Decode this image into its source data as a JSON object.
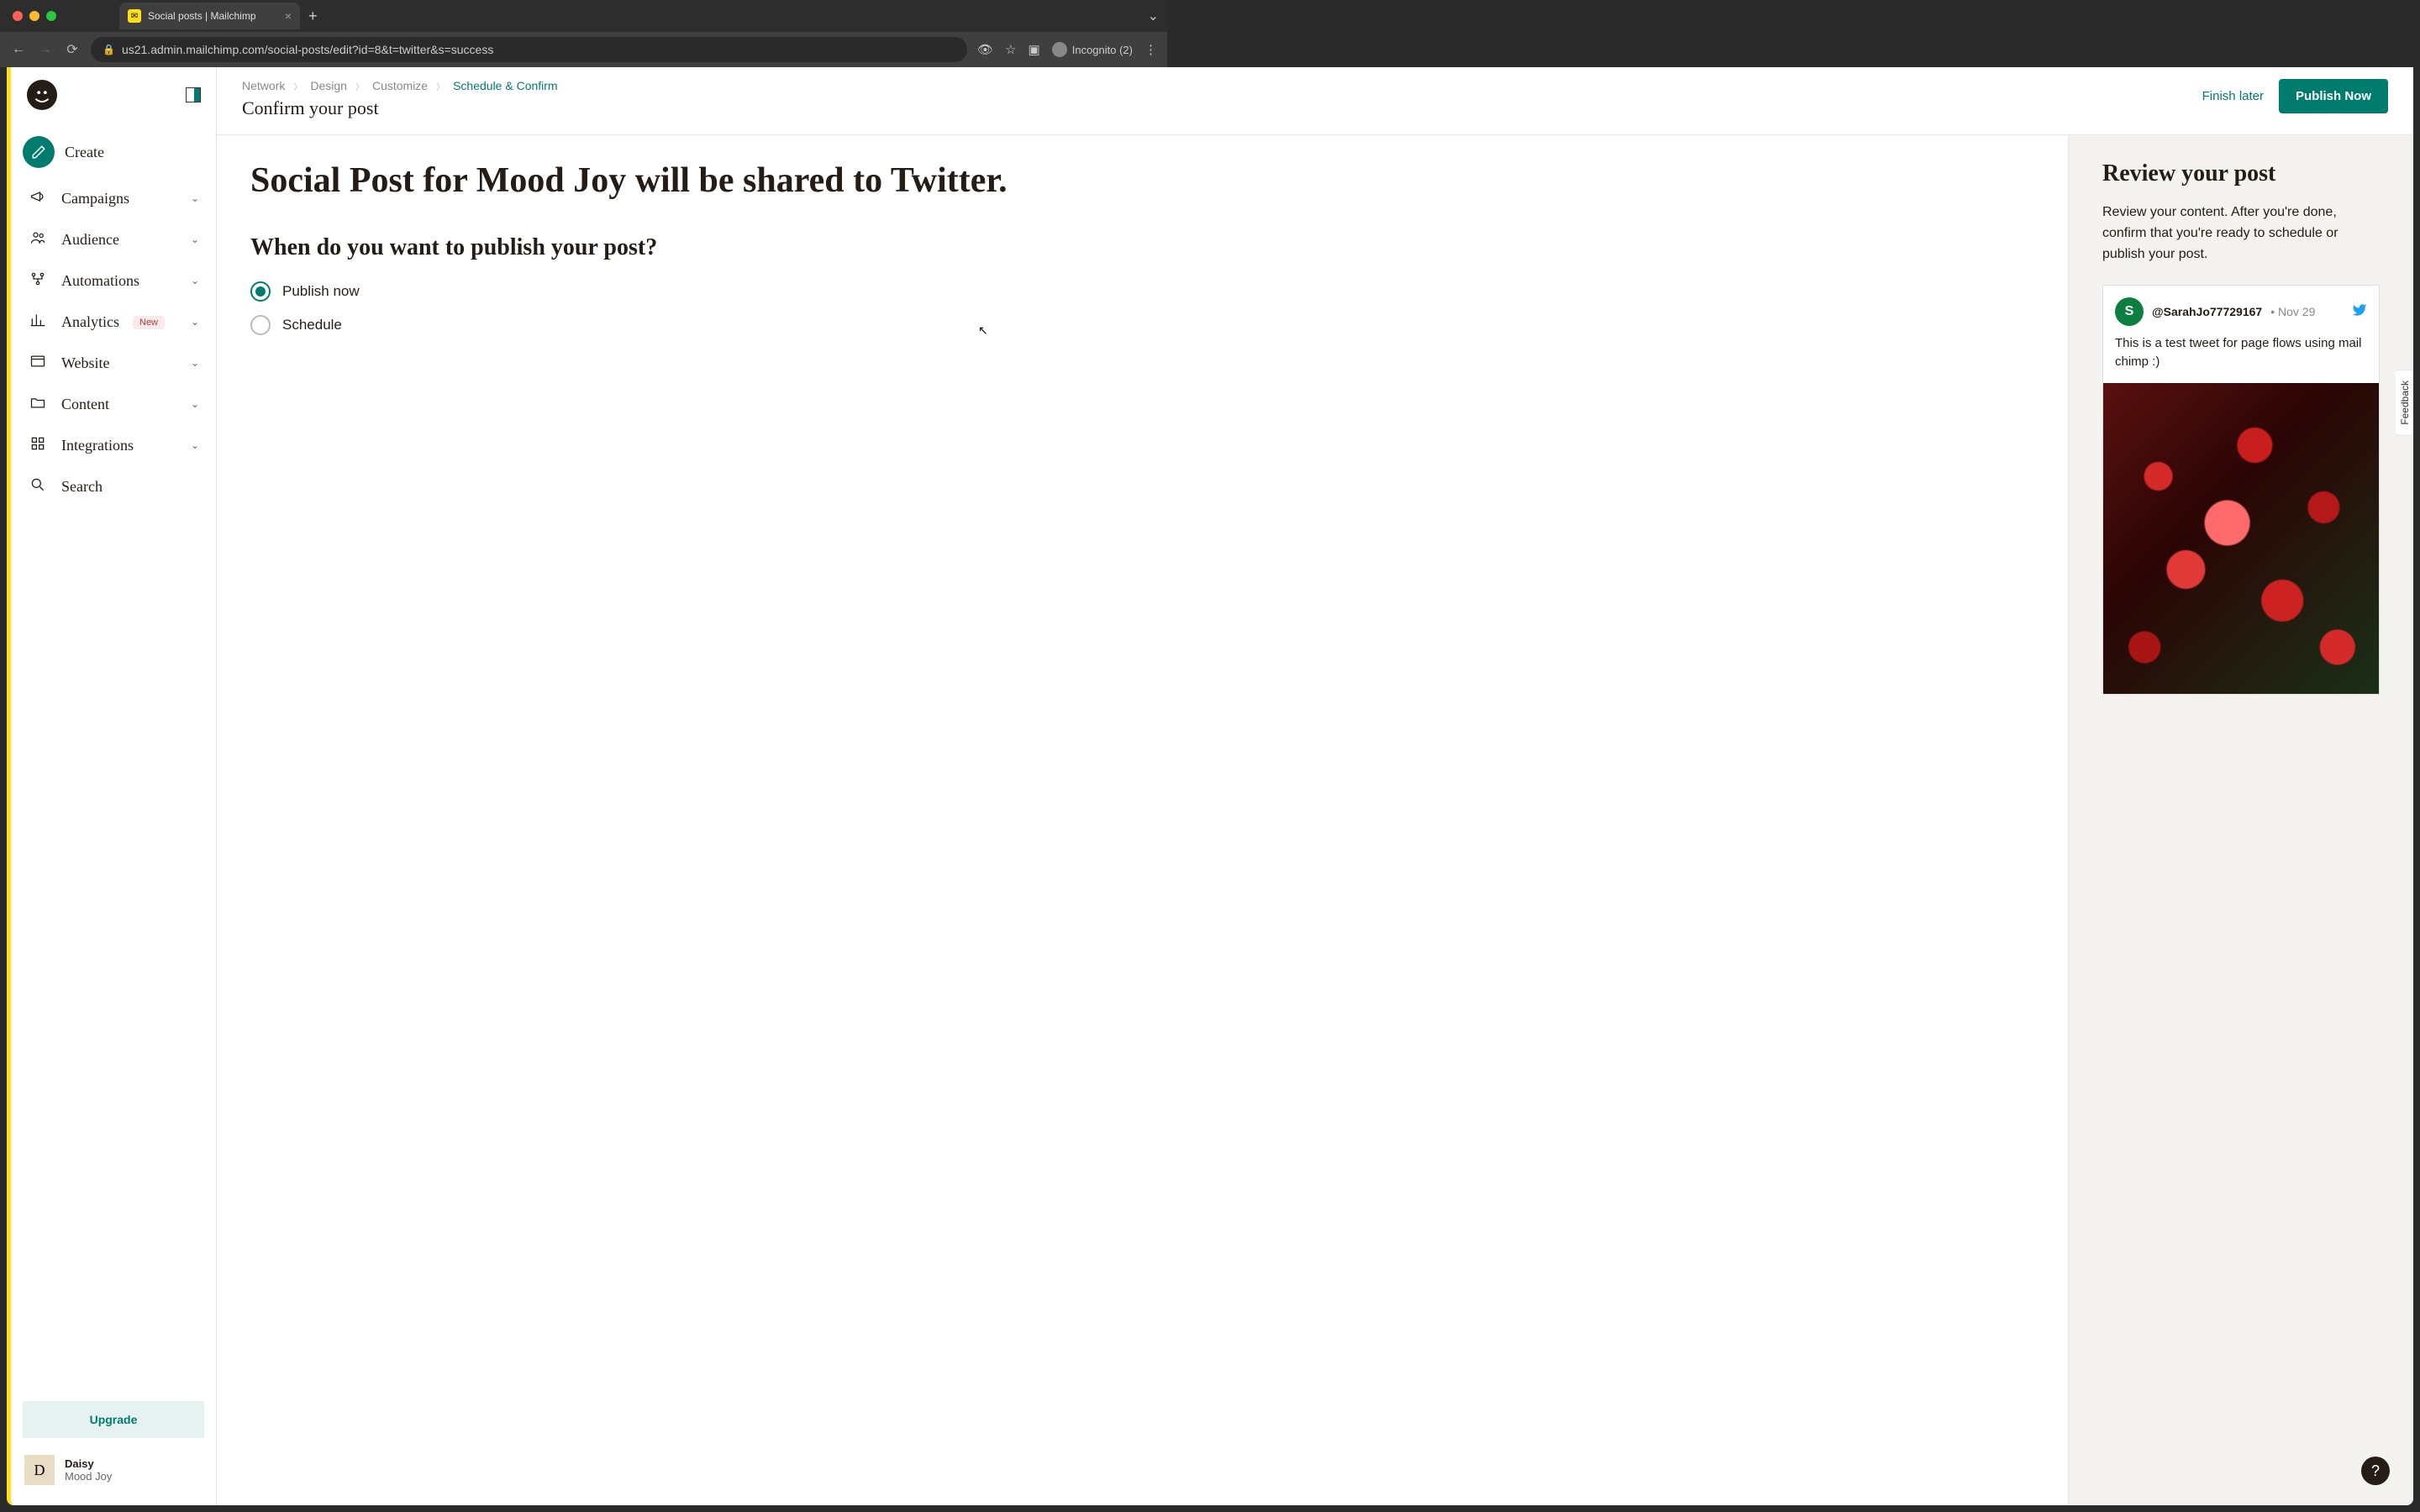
{
  "browser": {
    "tab_title": "Social posts | Mailchimp",
    "url": "us21.admin.mailchimp.com/social-posts/edit?id=8&t=twitter&s=success",
    "incognito_label": "Incognito (2)"
  },
  "sidebar": {
    "create": "Create",
    "items": [
      {
        "label": "Campaigns"
      },
      {
        "label": "Audience"
      },
      {
        "label": "Automations"
      },
      {
        "label": "Analytics",
        "badge": "New"
      },
      {
        "label": "Website"
      },
      {
        "label": "Content"
      },
      {
        "label": "Integrations"
      }
    ],
    "search": "Search",
    "upgrade": "Upgrade",
    "user": {
      "initial": "D",
      "name": "Daisy",
      "org": "Mood Joy"
    }
  },
  "breadcrumb": {
    "items": [
      "Network",
      "Design",
      "Customize",
      "Schedule & Confirm"
    ],
    "active_index": 3,
    "subtitle": "Confirm your post"
  },
  "header_actions": {
    "finish_later": "Finish later",
    "publish_now": "Publish Now"
  },
  "main": {
    "title": "Social Post for Mood Joy will be shared to Twitter.",
    "section_title": "When do you want to publish your post?",
    "options": {
      "publish_now": "Publish now",
      "schedule": "Schedule"
    }
  },
  "review": {
    "title": "Review your post",
    "description": "Review your content. After you're done, confirm that you're ready to schedule or publish your post.",
    "tweet": {
      "avatar_initial": "S",
      "handle": "@SarahJo77729167",
      "date": "Nov 29",
      "body": "This is a test tweet for page flows using mail chimp :)"
    }
  },
  "feedback_label": "Feedback",
  "help_label": "?"
}
